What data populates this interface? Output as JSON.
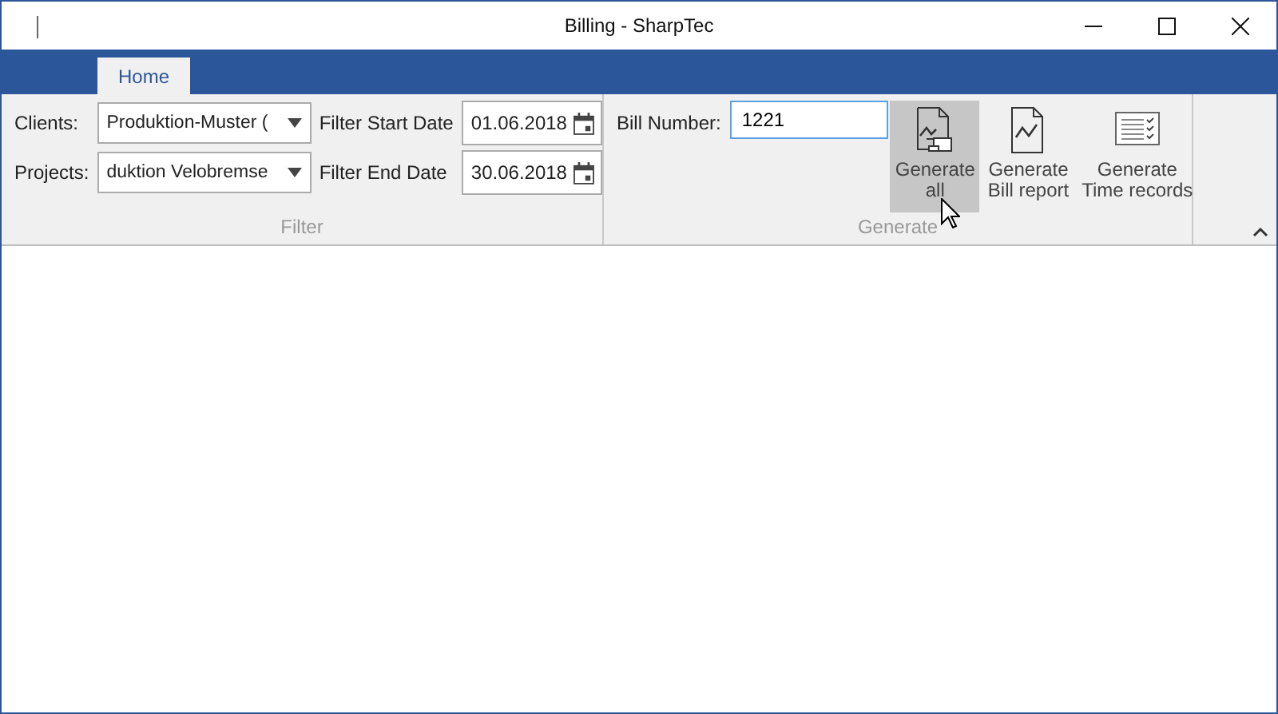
{
  "window": {
    "title": "Billing - SharpTec"
  },
  "tabs": [
    {
      "label": "Home",
      "selected": true
    }
  ],
  "filter": {
    "group_label": "Filter",
    "clients": {
      "label": "Clients:",
      "value": "Produktion-Muster ("
    },
    "projects": {
      "label": "Projects:",
      "value": "duktion Velobremse"
    },
    "start_date": {
      "label": "Filter Start Date",
      "value": "01.06.2018"
    },
    "end_date": {
      "label": "Filter End Date",
      "value": "30.06.2018"
    }
  },
  "generate": {
    "group_label": "Generate",
    "bill_number": {
      "label": "Bill Number:",
      "value": "1221"
    },
    "buttons": [
      {
        "kind": "chart-device",
        "lines": [
          "Generate",
          "all"
        ],
        "highlighted": true
      },
      {
        "kind": "chart",
        "lines": [
          "Generate",
          "Bill report"
        ],
        "highlighted": false
      },
      {
        "kind": "checklist",
        "lines": [
          "Generate",
          "Time records"
        ],
        "highlighted": false
      }
    ]
  }
}
